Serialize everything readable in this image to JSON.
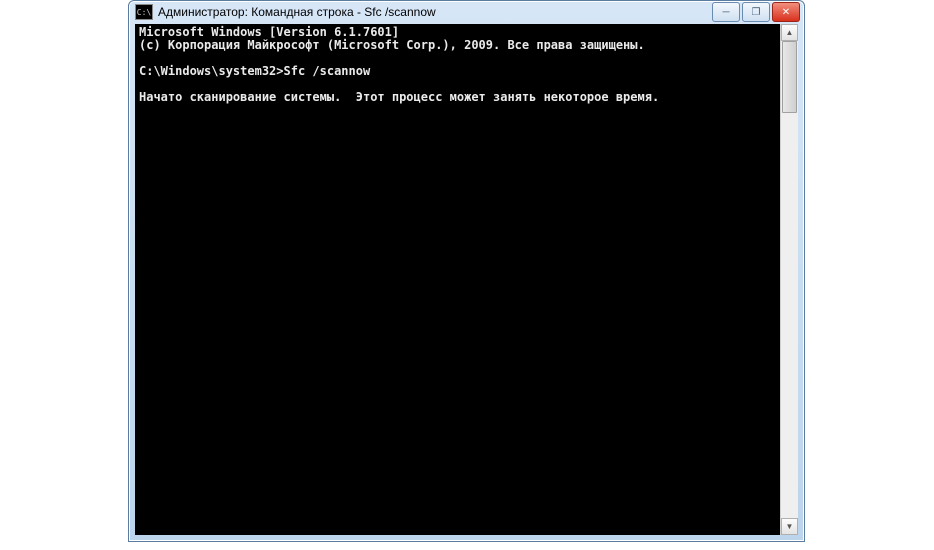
{
  "titlebar": {
    "icon_glyph": "C:\\",
    "title": "Администратор: Командная строка - Sfc  /scannow"
  },
  "window_controls": {
    "minimize_glyph": "─",
    "maximize_glyph": "❐",
    "close_glyph": "✕"
  },
  "console": {
    "line1": "Microsoft Windows [Version 6.1.7601]",
    "line2": "(c) Корпорация Майкрософт (Microsoft Corp.), 2009. Все права защищены.",
    "blank1": "",
    "prompt": "C:\\Windows\\system32>",
    "command": "Sfc /scannow",
    "blank2": "",
    "line3": "Начато сканирование системы.  Этот процесс может занять некоторое время."
  },
  "scrollbar": {
    "up_glyph": "▲",
    "down_glyph": "▼"
  }
}
